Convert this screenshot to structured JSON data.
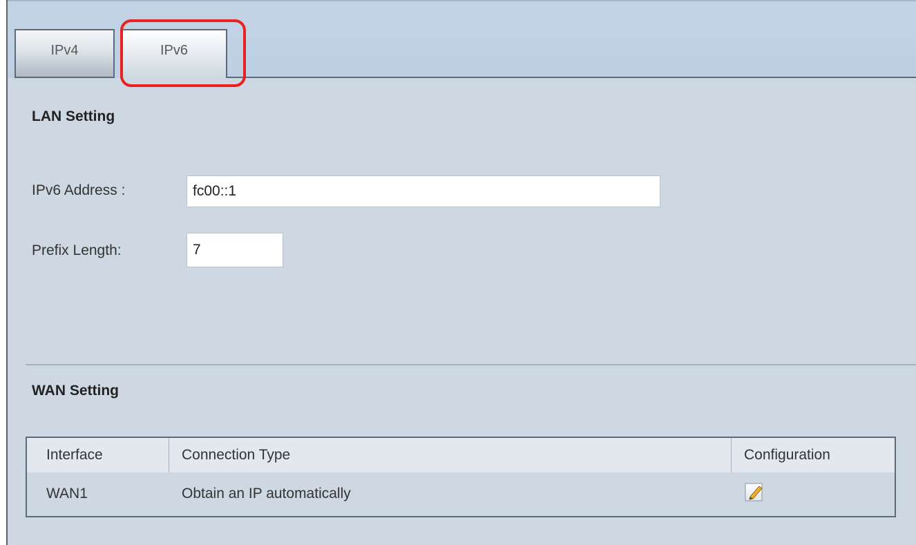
{
  "tabs": [
    {
      "label": "IPv4",
      "active": false
    },
    {
      "label": "IPv6",
      "active": true
    }
  ],
  "lan": {
    "title": "LAN Setting",
    "ipv6_address_label": "IPv6 Address :",
    "ipv6_address_value": "fc00::1",
    "prefix_length_label": "Prefix Length:",
    "prefix_length_value": "7"
  },
  "wan": {
    "title": "WAN Setting",
    "columns": [
      "Interface",
      "Connection Type",
      "Configuration"
    ],
    "rows": [
      {
        "interface": "WAN1",
        "connection_type": "Obtain an IP automatically",
        "configuration_icon": "edit-icon"
      }
    ]
  },
  "colors": {
    "highlight": "#e8231f",
    "panel_bg": "#cdd8e2"
  }
}
